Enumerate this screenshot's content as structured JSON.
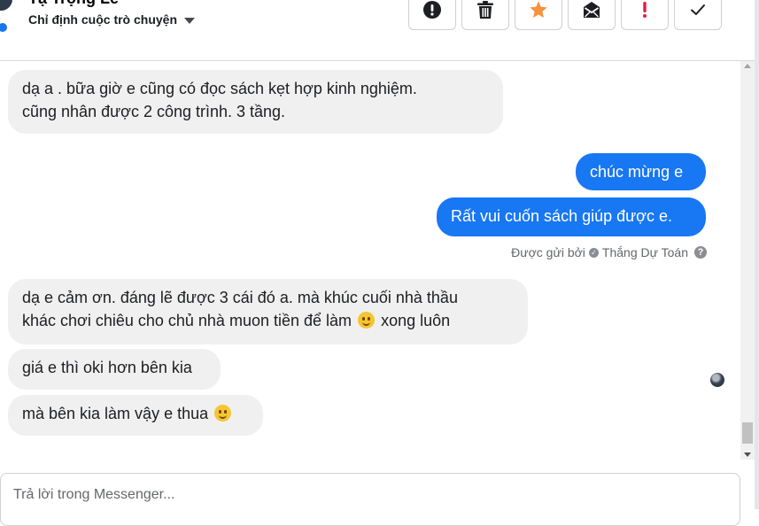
{
  "header": {
    "contact_name": "Tạ Trọng Lễ",
    "assign_label": "Chỉ định cuộc trò chuyện"
  },
  "toolbar": {
    "buttons": [
      {
        "icon": "alert-circle-icon",
        "color": "#1c1e21"
      },
      {
        "icon": "trash-icon",
        "color": "#1c1e21"
      },
      {
        "icon": "star-icon",
        "color": "#f7923b"
      },
      {
        "icon": "mail-icon",
        "color": "#1c1e21"
      },
      {
        "icon": "exclamation-icon",
        "color": "#e41e3f"
      },
      {
        "icon": "check-icon",
        "color": "#1c1e21"
      }
    ]
  },
  "messages": [
    {
      "direction": "incoming",
      "lines": [
        "dạ a . bữa giờ e cũng có đọc sách kẹt hợp kinh nghiệm.",
        "cũng nhân được 2 công trình. 3 tầng."
      ]
    },
    {
      "direction": "outgoing",
      "text": "chúc mừng e"
    },
    {
      "direction": "outgoing",
      "text": "Rất vui cuốn sách giúp được e."
    },
    {
      "direction": "incoming",
      "lines": [
        "dạ e cảm ơn. đáng lẽ được 3 cái đó a. mà khúc cuối nhà thầu",
        "khác chơi chiêu cho chủ nhà muon tiền để làm",
        "xong  luôn"
      ]
    },
    {
      "direction": "incoming",
      "text": "giá e thì oki hơn bên kia"
    },
    {
      "direction": "incoming",
      "text": "mà bên kia làm vậy e thua"
    }
  ],
  "sent_by": {
    "prefix": "Được gửi bởi",
    "name": "Thắng Dự Toán"
  },
  "composer": {
    "placeholder": "Trả lời trong Messenger..."
  },
  "colors": {
    "outgoing_bubble": "#1877f2",
    "incoming_bubble": "#f0f0f0"
  }
}
